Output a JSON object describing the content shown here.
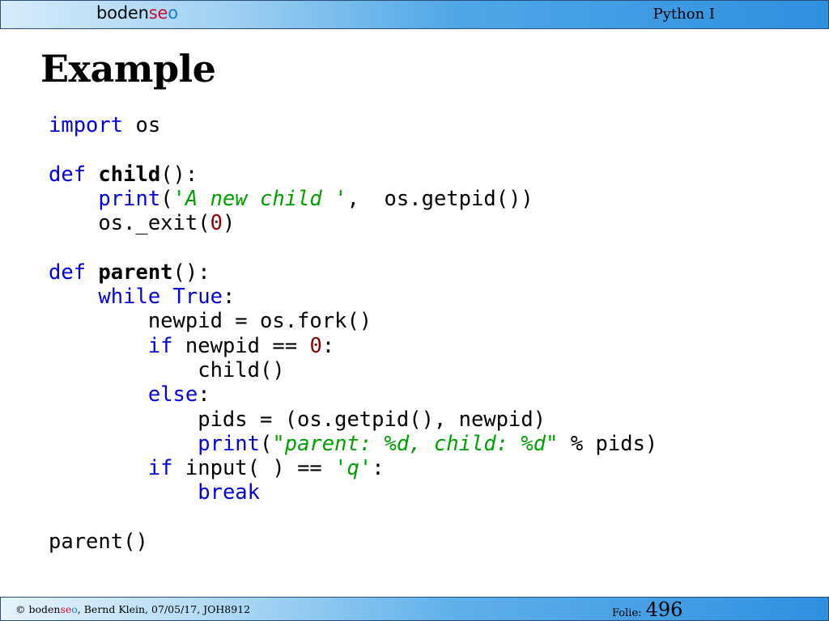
{
  "header": {
    "logo": {
      "part1": "boden",
      "part2": "se",
      "part3": "o"
    },
    "course": "Python I"
  },
  "title": "Example",
  "code_lines": [
    [
      {
        "t": "import",
        "c": "kw"
      },
      {
        "t": " os",
        "c": "plain"
      }
    ],
    [],
    [
      {
        "t": "def",
        "c": "kw"
      },
      {
        "t": " ",
        "c": "plain"
      },
      {
        "t": "child",
        "c": "fn"
      },
      {
        "t": "():",
        "c": "plain"
      }
    ],
    [
      {
        "t": "    ",
        "c": "plain"
      },
      {
        "t": "print",
        "c": "kw"
      },
      {
        "t": "(",
        "c": "plain"
      },
      {
        "t": "'A new child '",
        "c": "str"
      },
      {
        "t": ",  os.getpid())",
        "c": "plain"
      }
    ],
    [
      {
        "t": "    os._exit(",
        "c": "plain"
      },
      {
        "t": "0",
        "c": "num"
      },
      {
        "t": ")",
        "c": "plain"
      }
    ],
    [],
    [
      {
        "t": "def",
        "c": "kw"
      },
      {
        "t": " ",
        "c": "plain"
      },
      {
        "t": "parent",
        "c": "fn"
      },
      {
        "t": "():",
        "c": "plain"
      }
    ],
    [
      {
        "t": "    ",
        "c": "plain"
      },
      {
        "t": "while",
        "c": "kw"
      },
      {
        "t": " ",
        "c": "plain"
      },
      {
        "t": "True",
        "c": "kw"
      },
      {
        "t": ":",
        "c": "plain"
      }
    ],
    [
      {
        "t": "        newpid = os.fork()",
        "c": "plain"
      }
    ],
    [
      {
        "t": "        ",
        "c": "plain"
      },
      {
        "t": "if",
        "c": "kw"
      },
      {
        "t": " newpid == ",
        "c": "plain"
      },
      {
        "t": "0",
        "c": "num"
      },
      {
        "t": ":",
        "c": "plain"
      }
    ],
    [
      {
        "t": "            child()",
        "c": "plain"
      }
    ],
    [
      {
        "t": "        ",
        "c": "plain"
      },
      {
        "t": "else",
        "c": "kw"
      },
      {
        "t": ":",
        "c": "plain"
      }
    ],
    [
      {
        "t": "            pids = (os.getpid(), newpid)",
        "c": "plain"
      }
    ],
    [
      {
        "t": "            ",
        "c": "plain"
      },
      {
        "t": "print",
        "c": "kw"
      },
      {
        "t": "(",
        "c": "plain"
      },
      {
        "t": "\"parent: %d, child: %d\"",
        "c": "str"
      },
      {
        "t": " % pids)",
        "c": "plain"
      }
    ],
    [
      {
        "t": "        ",
        "c": "plain"
      },
      {
        "t": "if",
        "c": "kw"
      },
      {
        "t": " input( ) == ",
        "c": "plain"
      },
      {
        "t": "'q'",
        "c": "str"
      },
      {
        "t": ":",
        "c": "plain"
      }
    ],
    [
      {
        "t": "            ",
        "c": "plain"
      },
      {
        "t": "break",
        "c": "kw"
      }
    ],
    [],
    [
      {
        "t": "parent()",
        "c": "plain"
      }
    ]
  ],
  "footer": {
    "copyright_prefix": "© boden",
    "copyright_se": "se",
    "copyright_o": "o",
    "copyright_rest": ", Bernd Klein, 07/05/17, JOH8912",
    "folie_label": "Folie:",
    "folie_number": "496"
  }
}
